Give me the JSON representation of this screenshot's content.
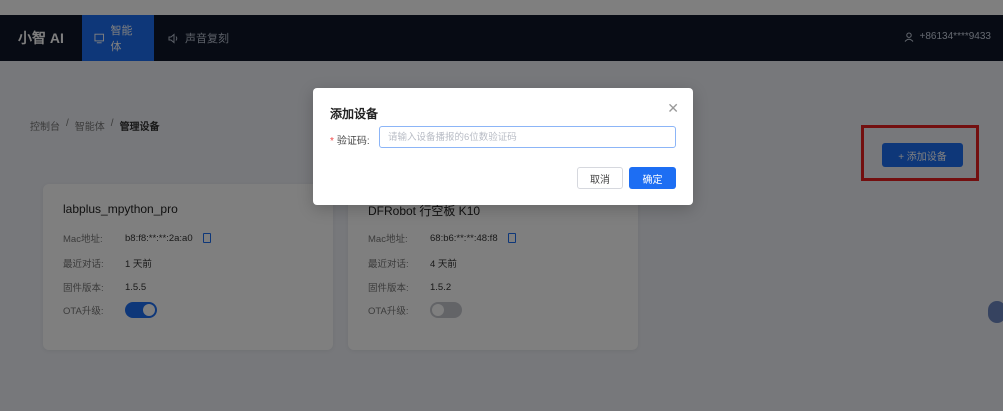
{
  "navbar": {
    "brand": "小智 AI",
    "tabs": [
      {
        "label": "智能体",
        "icon": "monitor-icon",
        "active": true
      },
      {
        "label": "声音复刻",
        "icon": "speaker-icon",
        "active": false
      }
    ],
    "user": "+86134****9433"
  },
  "breadcrumb": [
    "控制台",
    "智能体",
    "管理设备"
  ],
  "breadcrumb_sep": "/",
  "add_device_button": "+ 添加设备",
  "cards": [
    {
      "title": "labplus_mpython_pro",
      "mac_label": "Mac地址:",
      "mac": "b8:f8:**:**:2a:a0",
      "last_chat_label": "最近对话:",
      "last_chat": "1 天前",
      "firmware_label": "固件版本:",
      "firmware": "1.5.5",
      "ota_label": "OTA升级:",
      "ota_enabled": true
    },
    {
      "title": "DFRobot 行空板 K10",
      "mac_label": "Mac地址:",
      "mac": "68:b6:**:**:48:f8",
      "last_chat_label": "最近对话:",
      "last_chat": "4 天前",
      "firmware_label": "固件版本:",
      "firmware": "1.5.2",
      "ota_label": "OTA升级:",
      "ota_enabled": false
    }
  ],
  "modal": {
    "title": "添加设备",
    "field_label": "验证码:",
    "field_placeholder": "请输入设备播报的6位数验证码",
    "field_value": "",
    "cancel": "取消",
    "confirm": "确定"
  },
  "colors": {
    "accent": "#1d6ef3",
    "navbar": "#0e1729",
    "highlight": "#e61e1e"
  }
}
